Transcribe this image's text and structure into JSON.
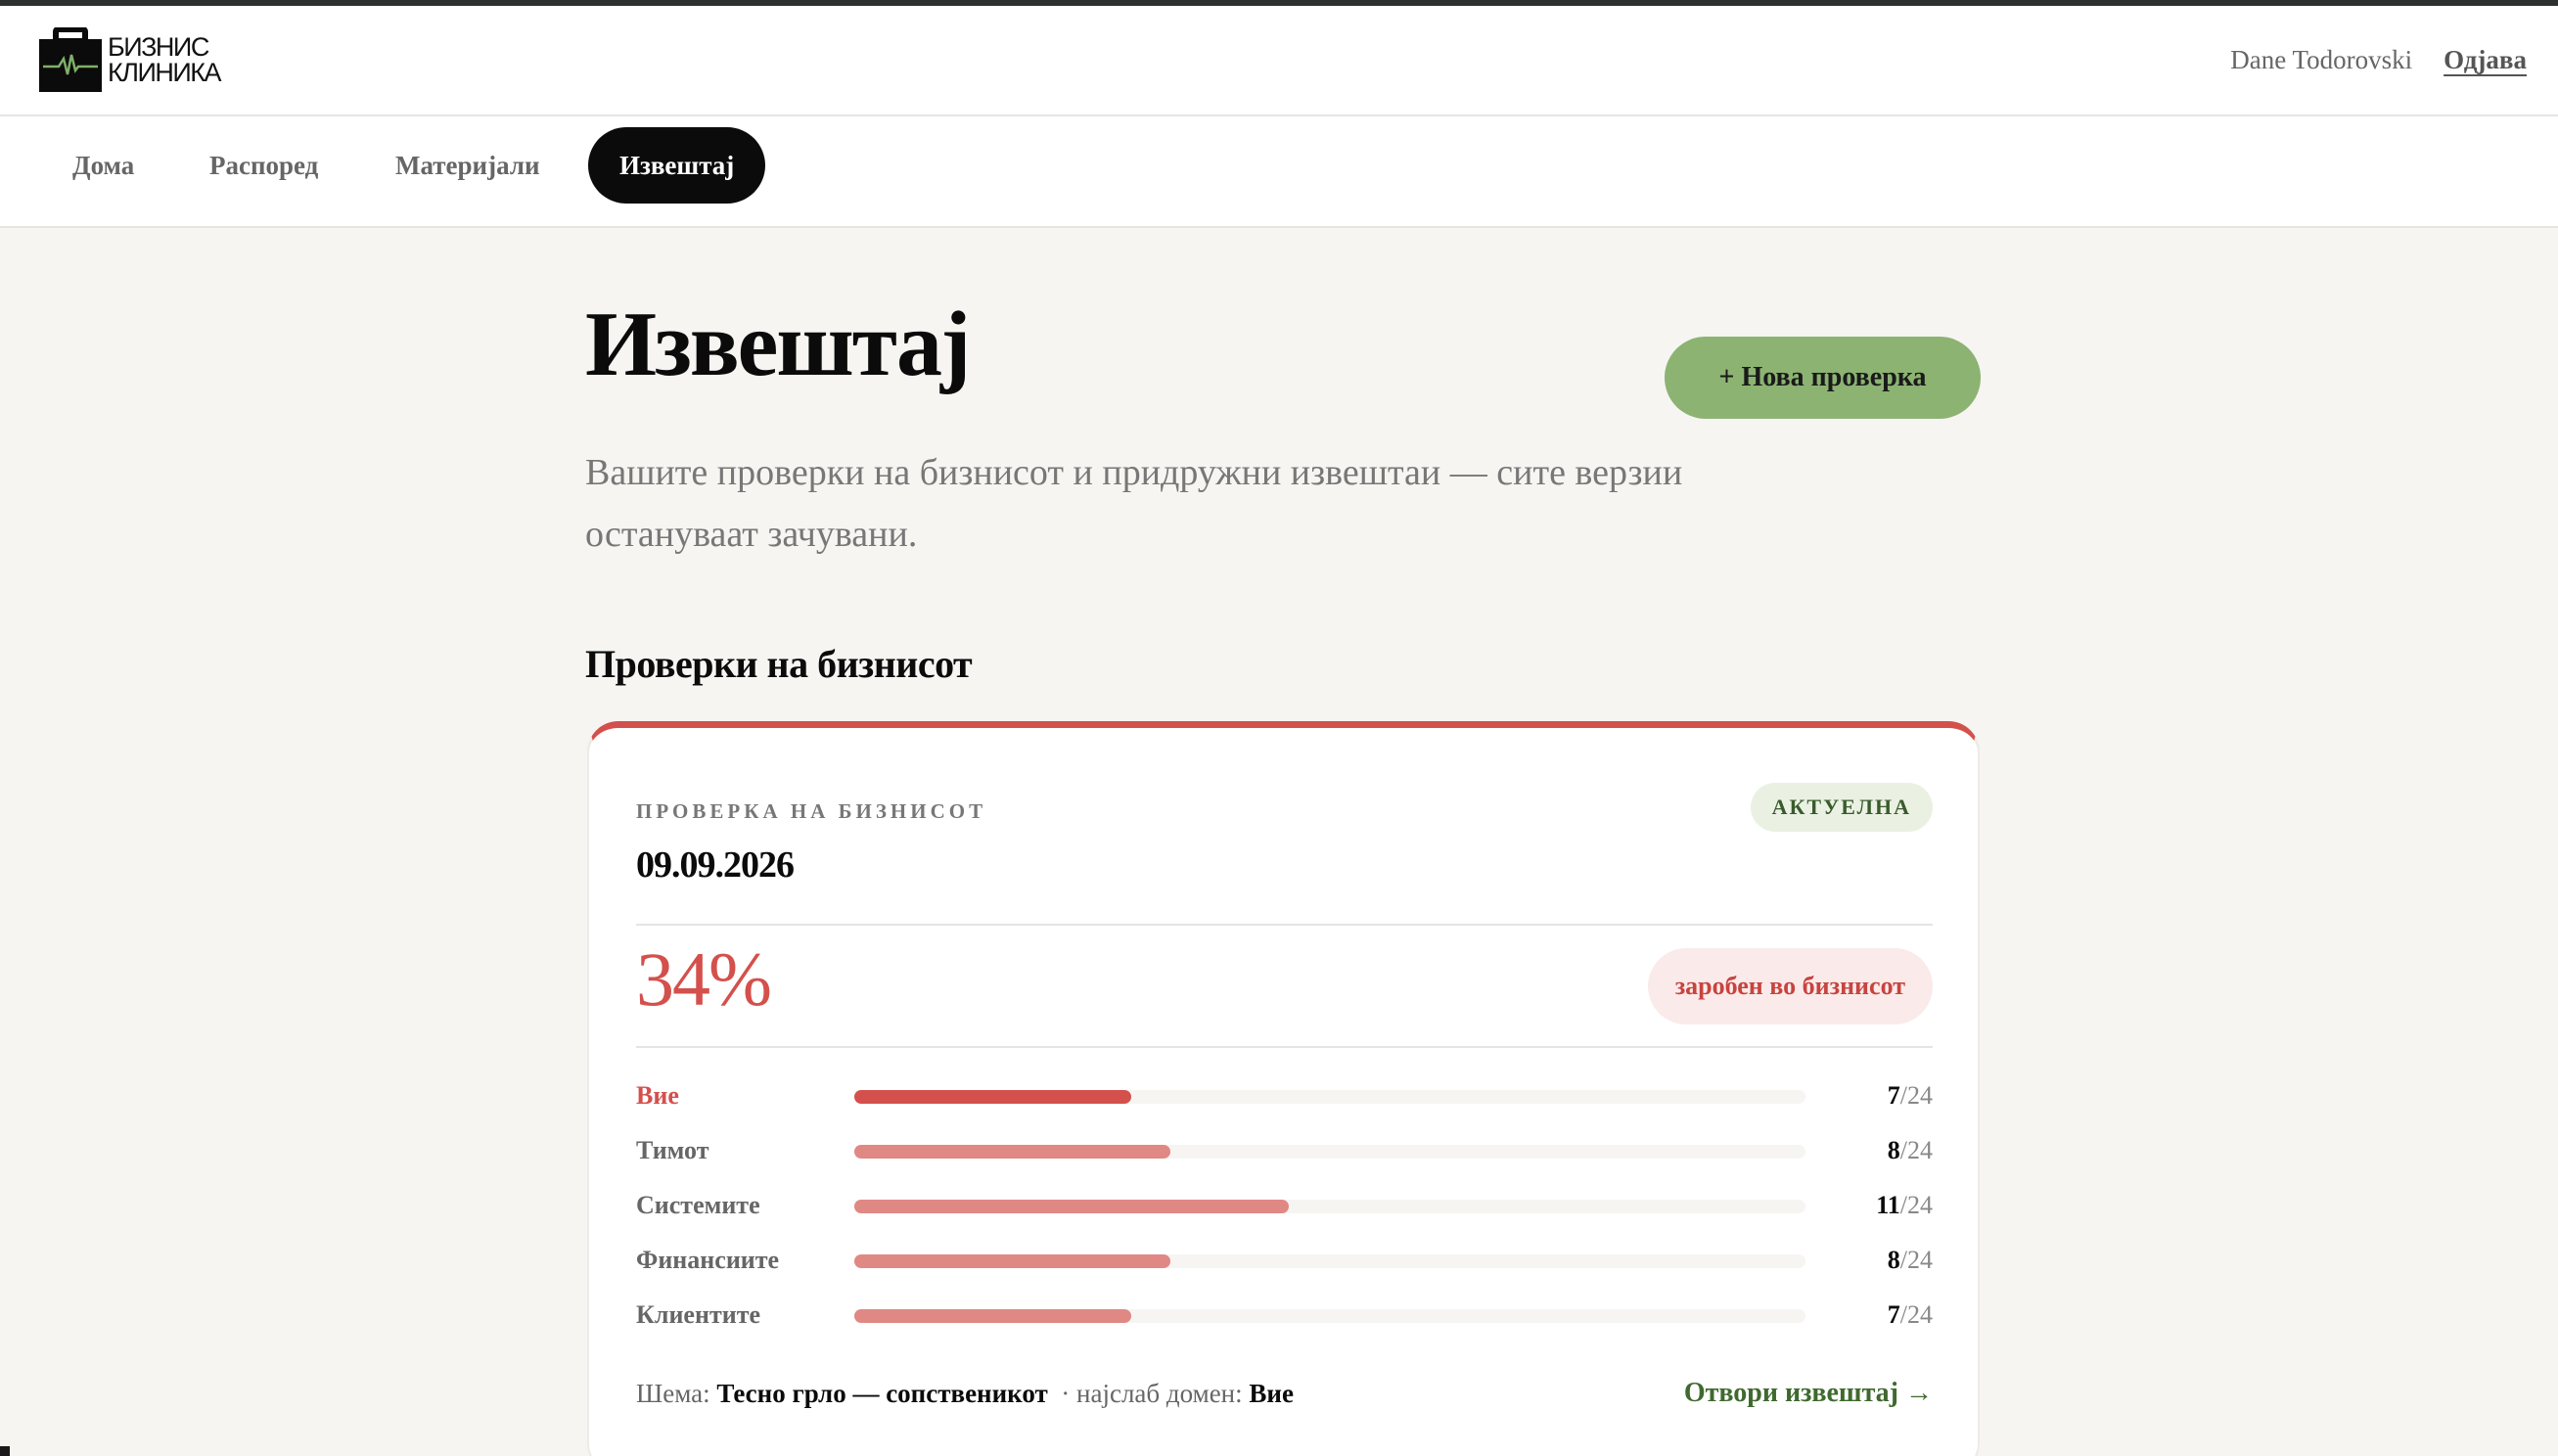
{
  "header": {
    "logo_line1": "БИЗНИС",
    "logo_line2": "КЛИНИКА",
    "user_name": "Dane Todorovski",
    "logout_label": "Одјава"
  },
  "nav": {
    "items": [
      {
        "label": "Дома",
        "active": false
      },
      {
        "label": "Распоред",
        "active": false
      },
      {
        "label": "Материјали",
        "active": false
      },
      {
        "label": "Извештај",
        "active": true
      }
    ]
  },
  "page": {
    "title": "Извештај",
    "new_check_label": "+ Нова проверка",
    "subtitle": "Вашите проверки на бизнисот и придружни извештаи — сите верзии остануваат зачувани.",
    "section_title": "Проверки на бизнисот"
  },
  "check": {
    "label": "ПРОВЕРКА НА БИЗНИСОТ",
    "date": "09.09.2026",
    "status": "АКТУЕЛНА",
    "score": "34%",
    "verdict": "заробен во бизнисот",
    "domains": [
      {
        "label": "Вие",
        "score": 7,
        "max": "/24",
        "weakest": true
      },
      {
        "label": "Тимот",
        "score": 8,
        "max": "/24",
        "weakest": false
      },
      {
        "label": "Системите",
        "score": 11,
        "max": "/24",
        "weakest": false
      },
      {
        "label": "Финансиите",
        "score": 8,
        "max": "/24",
        "weakest": false
      },
      {
        "label": "Клиентите",
        "score": 7,
        "max": "/24",
        "weakest": false
      }
    ],
    "scheme_prefix": "Шема:",
    "scheme_value": "Тесно грло — сопственикот",
    "weakest_prefix": "· најслаб домен:",
    "weakest_value": "Вие",
    "open_report_label": "Отвори извештај →"
  },
  "colors": {
    "accent_red": "#d4504c",
    "bar_red_light": "#e08884",
    "green_button": "#8cb372",
    "green_text": "#3f6a2e",
    "nav_active": "#0b0b0b"
  },
  "icons": {
    "logo": "briefcase-heartbeat-icon"
  }
}
